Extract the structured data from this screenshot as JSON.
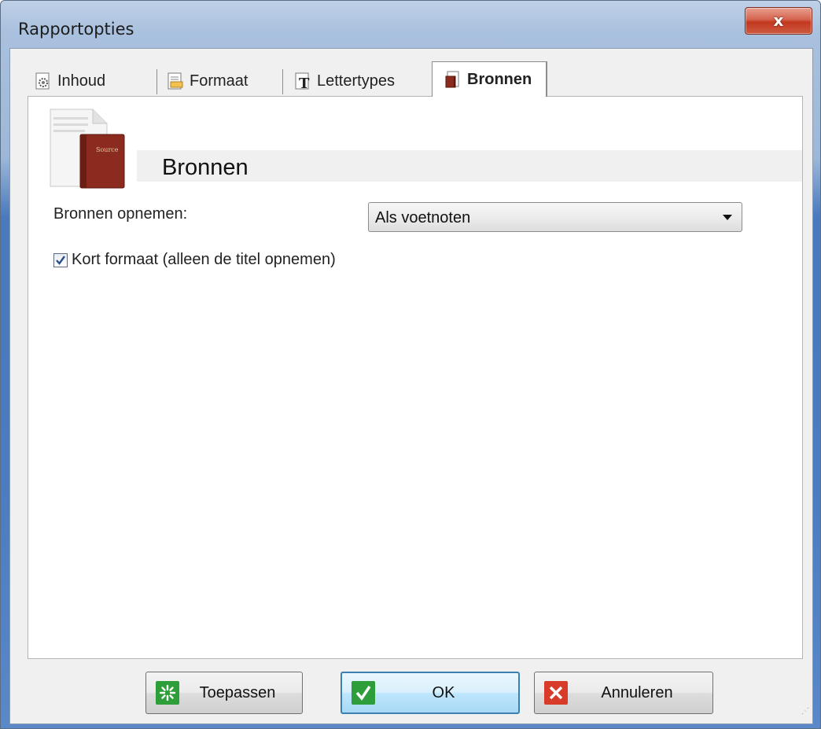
{
  "window": {
    "title": "Rapportopties",
    "close_label": "x"
  },
  "tabs": [
    {
      "label": "Inhoud",
      "icon": "content-gear-icon"
    },
    {
      "label": "Formaat",
      "icon": "format-icon"
    },
    {
      "label": "Lettertypes",
      "icon": "font-icon"
    },
    {
      "label": "Bronnen",
      "icon": "book-icon",
      "selected": true
    }
  ],
  "section": {
    "title": "Bronnen",
    "icon": "sources-book-icon",
    "book_label": "Source"
  },
  "form": {
    "include_label": "Bronnen opnemen:",
    "include_value": "Als voetnoten",
    "short_format_label": "Kort formaat (alleen de titel opnemen)",
    "short_format_checked": true
  },
  "buttons": {
    "apply": "Toepassen",
    "ok": "OK",
    "cancel": "Annuleren"
  },
  "colors": {
    "apply_icon": "#2e9e3a",
    "ok_icon": "#2e9e3a",
    "cancel_icon": "#d83b2a",
    "book": "#8b2a1e"
  }
}
